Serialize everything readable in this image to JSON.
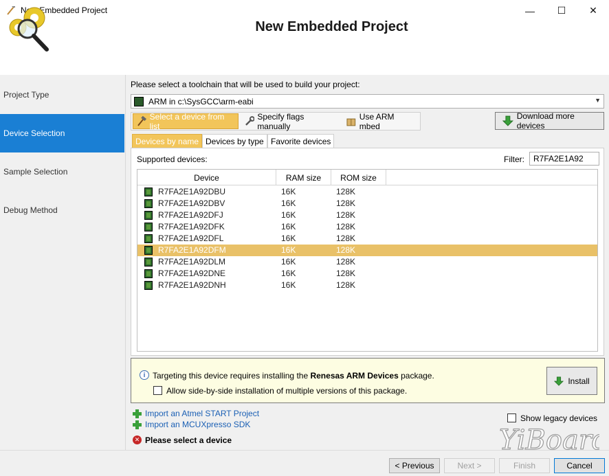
{
  "window": {
    "title": "New Embedded Project",
    "minimize": "—",
    "maximize": "☐",
    "close": "✕"
  },
  "header": {
    "title": "New Embedded Project"
  },
  "sidebar": {
    "items": [
      {
        "label": "Project Type"
      },
      {
        "label": "Device Selection",
        "active": true
      },
      {
        "label": "Sample Selection"
      },
      {
        "label": "Debug Method"
      }
    ]
  },
  "toolchain": {
    "prompt": "Please select a toolchain that will be used to build your project:",
    "selected": "ARM in c:\\SysGCC\\arm-eabi"
  },
  "modes": {
    "select_from_list": "Select a device from list",
    "specify_flags": "Specify flags manually",
    "use_mbed": "Use ARM mbed"
  },
  "download_button": "Download more devices",
  "tabs": [
    {
      "label": "Devices by name",
      "active": true
    },
    {
      "label": "Devices by type"
    },
    {
      "label": "Favorite devices"
    }
  ],
  "devices": {
    "supported_label": "Supported devices:",
    "filter_label": "Filter:",
    "filter_value": "R7FA2E1A92",
    "columns": [
      "Device",
      "RAM size",
      "ROM size"
    ],
    "rows": [
      {
        "device": "R7FA2E1A92DBU",
        "ram": "16K",
        "rom": "128K"
      },
      {
        "device": "R7FA2E1A92DBV",
        "ram": "16K",
        "rom": "128K"
      },
      {
        "device": "R7FA2E1A92DFJ",
        "ram": "16K",
        "rom": "128K"
      },
      {
        "device": "R7FA2E1A92DFK",
        "ram": "16K",
        "rom": "128K"
      },
      {
        "device": "R7FA2E1A92DFL",
        "ram": "16K",
        "rom": "128K"
      },
      {
        "device": "R7FA2E1A92DFM",
        "ram": "16K",
        "rom": "128K",
        "selected": true
      },
      {
        "device": "R7FA2E1A92DLM",
        "ram": "16K",
        "rom": "128K"
      },
      {
        "device": "R7FA2E1A92DNE",
        "ram": "16K",
        "rom": "128K"
      },
      {
        "device": "R7FA2E1A92DNH",
        "ram": "16K",
        "rom": "128K"
      }
    ]
  },
  "info": {
    "text_before": "Targeting this device requires installing the ",
    "package": "Renesas ARM Devices",
    "text_after": " package.",
    "side_by_side": "Allow side-by-side installation of multiple versions of this package.",
    "install": "Install"
  },
  "links": {
    "import_atmel": "Import an Atmel START Project",
    "import_mcux": "Import an MCUXpresso SDK"
  },
  "show_legacy": "Show legacy devices",
  "error": "Please select a device",
  "watermark": "YiBoard",
  "nav": {
    "previous": "< Previous",
    "next": "Next >",
    "finish": "Finish",
    "cancel": "Cancel"
  },
  "colors": {
    "accent": "#1a7fd4",
    "selection": "#e9c168",
    "info_bg": "#fdfde2"
  }
}
